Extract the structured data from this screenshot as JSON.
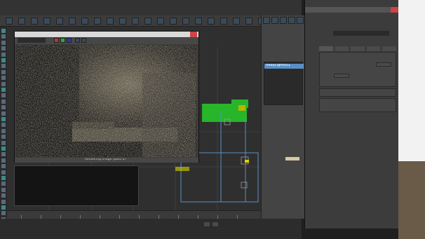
{
  "window": {
    "title": "",
    "menus": [
      "",
      "",
      "",
      "",
      "",
      "",
      "",
      "",
      "",
      "",
      "",
      "",
      "",
      "",
      ""
    ]
  },
  "toolbar": {
    "icons": 22
  },
  "left_strip": {
    "icons": 34
  },
  "frame_buffer": {
    "title": "",
    "channel_label": "",
    "render_status": "Rendering image (pass 4)"
  },
  "modifier_panel": {
    "object_name": "VRayLight001",
    "rollouts": [
      "",
      "",
      "",
      "",
      "",
      "",
      "",
      ""
    ],
    "params": [
      "",
      "",
      "",
      "",
      "",
      "",
      "",
      "",
      "",
      "",
      "",
      ""
    ]
  },
  "render_setup": {
    "title": "",
    "renderer": "",
    "tabs": [
      "",
      "",
      "",
      "",
      ""
    ],
    "section_titles": [
      "",
      "",
      ""
    ]
  },
  "timeline": {
    "frame": "",
    "ticks": 12
  },
  "statusbar": {
    "coords": "",
    "hint": ""
  },
  "colors": {
    "viewport_bg": "#2f2f2f",
    "selection_green": "#27b52a",
    "gizmo_yellow": "#d9d400",
    "accent_blue": "#5a8fc6",
    "render_dark": "#1a1a1a"
  }
}
